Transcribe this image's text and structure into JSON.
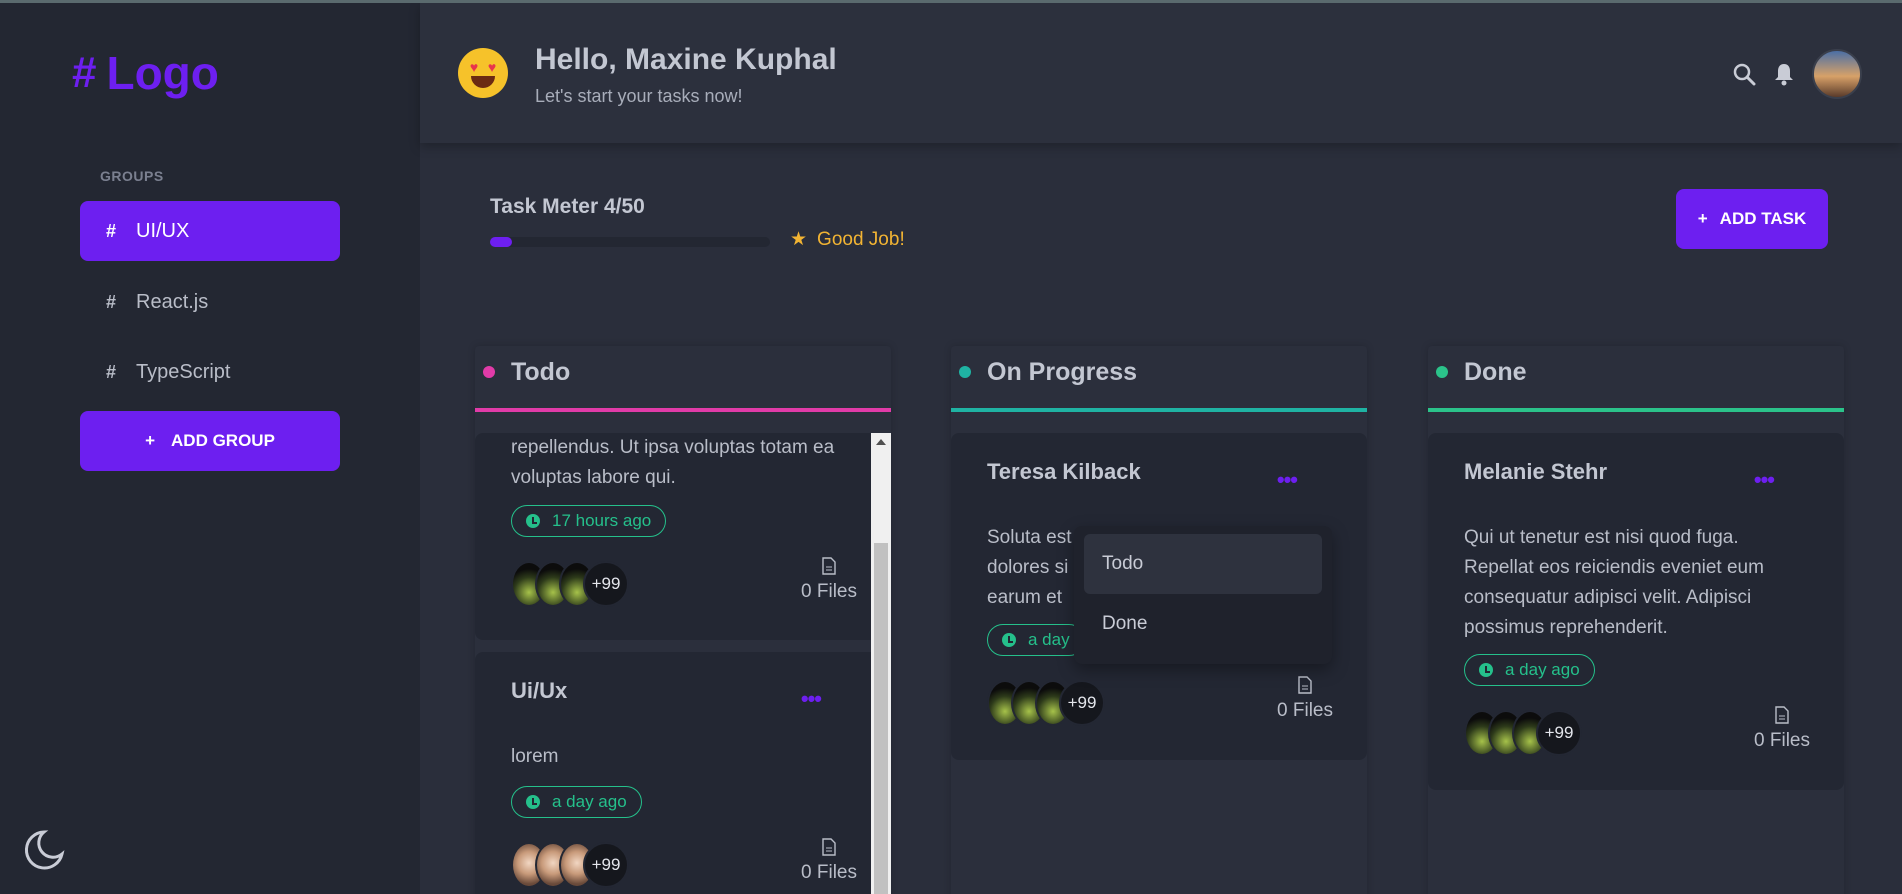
{
  "sidebar": {
    "logo": "Logo",
    "groups_label": "GROUPS",
    "items": [
      {
        "label": "UI/UX",
        "active": true
      },
      {
        "label": "React.js",
        "active": false
      },
      {
        "label": "TypeScript",
        "active": false
      }
    ],
    "add_group": "ADD GROUP"
  },
  "header": {
    "greeting": "Hello, Maxine Kuphal",
    "subtitle": "Let's start your tasks now!"
  },
  "meter": {
    "title": "Task Meter 4/50",
    "progress": 0.08,
    "message": "Good Job!"
  },
  "actions": {
    "add_task": "ADD TASK"
  },
  "columns": [
    {
      "title": "Todo",
      "color": "#e13ba8",
      "cards": [
        {
          "name": "",
          "desc": "repellendus. Ut ipsa voluptas totam ea voluptas labore qui.",
          "time": "17 hours ago",
          "more": "+99",
          "files": "0 Files"
        },
        {
          "name": "Ui/Ux",
          "desc": "lorem",
          "time": "a day ago",
          "more": "+99",
          "files": "0 Files"
        }
      ]
    },
    {
      "title": "On Progress",
      "color": "#1fb3a3",
      "cards": [
        {
          "name": "Teresa Kilback",
          "desc_lines": [
            "Soluta est",
            "dolores si",
            "earum et"
          ],
          "time": "a day",
          "more": "+99",
          "files": "0 Files"
        }
      ]
    },
    {
      "title": "Done",
      "color": "#2bc38a",
      "cards": [
        {
          "name": "Melanie Stehr",
          "desc": "Qui ut tenetur est nisi quod fuga. Repellat eos reiciendis eveniet eum consequatur adipisci velit. Adipisci possimus reprehenderit.",
          "time": "a day ago",
          "more": "+99",
          "files": "0 Files"
        }
      ]
    }
  ],
  "dropdown": {
    "options": [
      "Todo",
      "Done"
    ]
  },
  "colors": {
    "accent": "#6d1ff0",
    "success": "#25c08b",
    "warning": "#f2b433"
  }
}
